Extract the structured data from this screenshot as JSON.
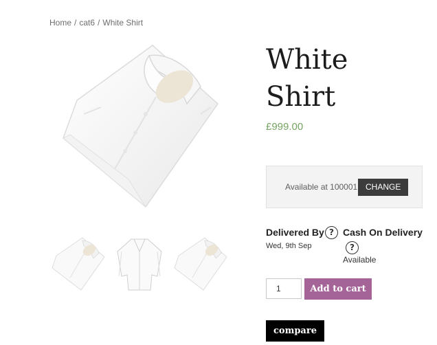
{
  "breadcrumb": {
    "home": "Home",
    "separator": "/",
    "category": "cat6",
    "current": "White Shirt"
  },
  "product": {
    "title": "White Shirt",
    "price": "£999.00",
    "price_color": "#77a464",
    "main_image_icon": "folded-white-shirt-image",
    "thumbnails": [
      {
        "icon": "folded-white-shirt-thumbnail"
      },
      {
        "icon": "open-white-shirt-thumbnail"
      },
      {
        "icon": "folded-white-shirt-thumbnail"
      }
    ]
  },
  "availability": {
    "text": "Available at 100001",
    "change_label": "CHANGE"
  },
  "delivery": {
    "title": "Delivered By",
    "date": "Wed, 9th Sep",
    "help_symbol": "?"
  },
  "cod": {
    "title": "Cash On Delivery",
    "help_symbol": "?",
    "status": "Available"
  },
  "cart": {
    "quantity": "1",
    "add_label": "Add to cart",
    "accent_color": "#a46497"
  },
  "compare": {
    "label": "compare"
  }
}
